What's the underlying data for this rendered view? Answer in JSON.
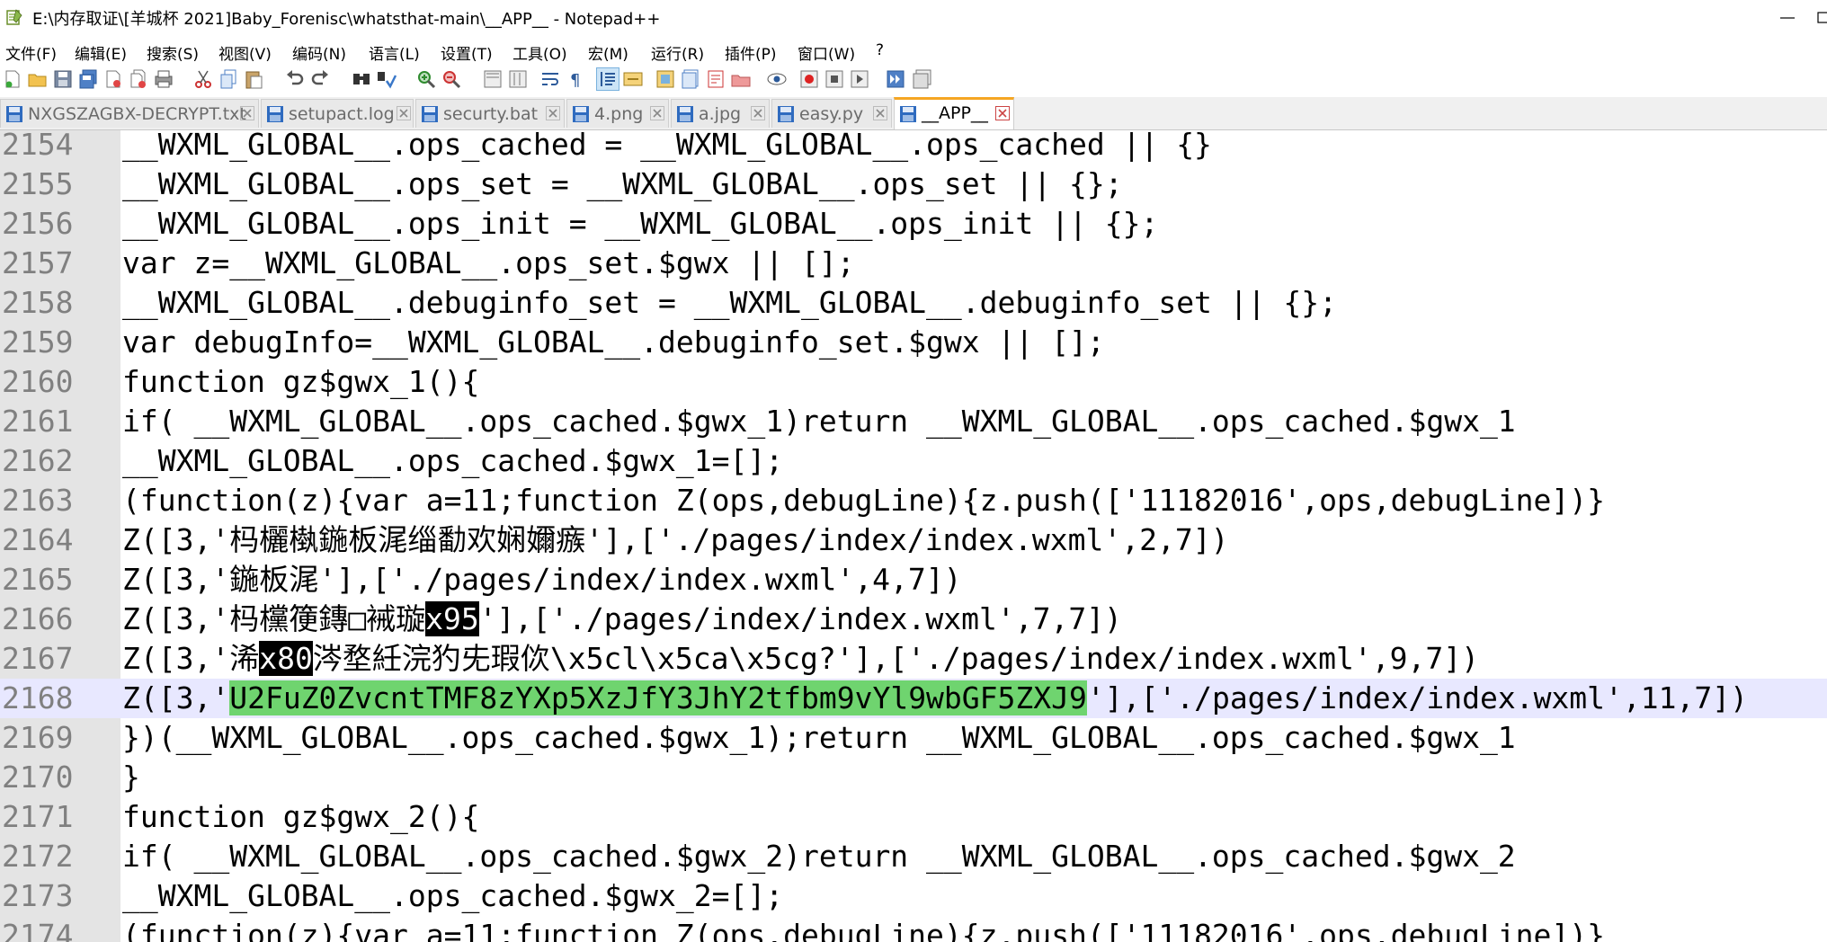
{
  "window": {
    "title": "E:\\内存取证\\[羊城杯 2021]Baby_Forenisc\\whatsthat-main\\__APP__ - Notepad++"
  },
  "menu": {
    "items": [
      "文件(F)",
      "编辑(E)",
      "搜索(S)",
      "视图(V)",
      "编码(N)",
      "语言(L)",
      "设置(T)",
      "工具(O)",
      "宏(M)",
      "运行(R)",
      "插件(P)",
      "窗口(W)",
      "?"
    ]
  },
  "toolbar": {
    "icons": [
      "new-file-icon",
      "open-file-icon",
      "save-icon",
      "save-all-icon",
      "close-icon",
      "close-all-icon",
      "print-icon",
      "cut-icon",
      "copy-icon",
      "paste-icon",
      "undo-icon",
      "redo-icon",
      "find-icon",
      "replace-icon",
      "zoom-in-icon",
      "zoom-out-icon",
      "sync-vertical-icon",
      "sync-horizontal-icon",
      "word-wrap-icon",
      "show-all-chars-icon",
      "indent-guide-icon",
      "language-udl-icon",
      "doc-map-icon",
      "function-list-icon",
      "folder-workspace-icon",
      "monitoring-icon",
      "macro-record-icon",
      "macro-stop-icon",
      "macro-play-icon",
      "macro-run-multiple-icon",
      "macro-save-icon"
    ]
  },
  "tabs": [
    {
      "label": "NXGSZAGBX-DECRYPT.txt",
      "active": false
    },
    {
      "label": "setupact.log",
      "active": false
    },
    {
      "label": "securty.bat",
      "active": false
    },
    {
      "label": "4.png",
      "active": false
    },
    {
      "label": "a.jpg",
      "active": false
    },
    {
      "label": "easy.py",
      "active": false
    },
    {
      "label": "__APP__",
      "active": true
    }
  ],
  "editor": {
    "lines": [
      {
        "num": "2154",
        "segments": [
          {
            "text": "__WXML_GLOBAL__.ops_cached = __WXML_GLOBAL__.ops_cached || {}",
            "style": ""
          }
        ]
      },
      {
        "num": "2155",
        "segments": [
          {
            "text": "__WXML_GLOBAL__.ops_set = __WXML_GLOBAL__.ops_set || {};",
            "style": ""
          }
        ]
      },
      {
        "num": "2156",
        "segments": [
          {
            "text": "__WXML_GLOBAL__.ops_init = __WXML_GLOBAL__.ops_init || {};",
            "style": ""
          }
        ]
      },
      {
        "num": "2157",
        "segments": [
          {
            "text": "var z=__WXML_GLOBAL__.ops_set.$gwx || [];",
            "style": ""
          }
        ]
      },
      {
        "num": "2158",
        "segments": [
          {
            "text": "__WXML_GLOBAL__.debuginfo_set = __WXML_GLOBAL__.debuginfo_set || {};",
            "style": ""
          }
        ]
      },
      {
        "num": "2159",
        "segments": [
          {
            "text": "var debugInfo=__WXML_GLOBAL__.debuginfo_set.$gwx || [];",
            "style": ""
          }
        ]
      },
      {
        "num": "2160",
        "segments": [
          {
            "text": "function gz$gwx_1(){",
            "style": ""
          }
        ]
      },
      {
        "num": "2161",
        "segments": [
          {
            "text": "if( __WXML_GLOBAL__.ops_cached.$gwx_1)return __WXML_GLOBAL__.ops_cached.$gwx_1",
            "style": ""
          }
        ]
      },
      {
        "num": "2162",
        "segments": [
          {
            "text": "__WXML_GLOBAL__.ops_cached.$gwx_1=[];",
            "style": ""
          }
        ]
      },
      {
        "num": "2163",
        "segments": [
          {
            "text": "(function(z){var a=11;function Z(ops,debugLine){z.push(['11182016',ops,debugLine])}",
            "style": ""
          }
        ]
      },
      {
        "num": "2164",
        "segments": [
          {
            "text": "Z([3,'杩欐槸鍦板浘缁勫欢娴嬭瘯'],['./pages/index/index.wxml',2,7])",
            "style": ""
          }
        ]
      },
      {
        "num": "2165",
        "segments": [
          {
            "text": "Z([3,'鍦板浘'],['./pages/index/index.wxml',4,7])",
            "style": ""
          }
        ]
      },
      {
        "num": "2166",
        "segments": [
          {
            "text": "Z([3,'杩欓箯鏄□裓璇",
            "style": ""
          },
          {
            "text": "x95",
            "style": "ctrl"
          },
          {
            "text": "'],['./pages/index/index.wxml',7,7])",
            "style": ""
          }
        ]
      },
      {
        "num": "2167",
        "segments": [
          {
            "text": "Z([3,'浠",
            "style": ""
          },
          {
            "text": "x80",
            "style": "ctrl"
          },
          {
            "text": "涔堥紝浣犳兂瑕佽\\x5cl\\x5ca\\x5cg?'],['./pages/index/index.wxml',9,7])",
            "style": ""
          }
        ]
      },
      {
        "num": "2168",
        "segments": [
          {
            "text": "Z([3,'",
            "style": ""
          },
          {
            "text": "U2FuZ0ZvcntTMF8zYXp5XzJfY3JhY2tfbm9vYl9wbGF5ZXJ9",
            "style": "sel"
          },
          {
            "text": "'],['./pages/index/index.wxml',11,7])",
            "style": ""
          }
        ]
      },
      {
        "num": "2169",
        "segments": [
          {
            "text": "})(__WXML_GLOBAL__.ops_cached.$gwx_1);return __WXML_GLOBAL__.ops_cached.$gwx_1",
            "style": ""
          }
        ]
      },
      {
        "num": "2170",
        "segments": [
          {
            "text": "}",
            "style": ""
          }
        ]
      },
      {
        "num": "2171",
        "segments": [
          {
            "text": "function gz$gwx_2(){",
            "style": ""
          }
        ]
      },
      {
        "num": "2172",
        "segments": [
          {
            "text": "if( __WXML_GLOBAL__.ops_cached.$gwx_2)return __WXML_GLOBAL__.ops_cached.$gwx_2",
            "style": ""
          }
        ]
      },
      {
        "num": "2173",
        "segments": [
          {
            "text": "__WXML_GLOBAL__.ops_cached.$gwx_2=[];",
            "style": ""
          }
        ]
      },
      {
        "num": "2174",
        "segments": [
          {
            "text": "(function(z){var a=11;function Z(ops,debugLine){z.push(['11182016',ops,debugLine])}",
            "style": ""
          }
        ]
      }
    ],
    "current_line": "2168"
  },
  "colors": {
    "selection": "#6fd46f",
    "current_line": "#e8e8ff",
    "gutter": "#e4e4e4",
    "active_tab_accent": "#f5a623"
  }
}
